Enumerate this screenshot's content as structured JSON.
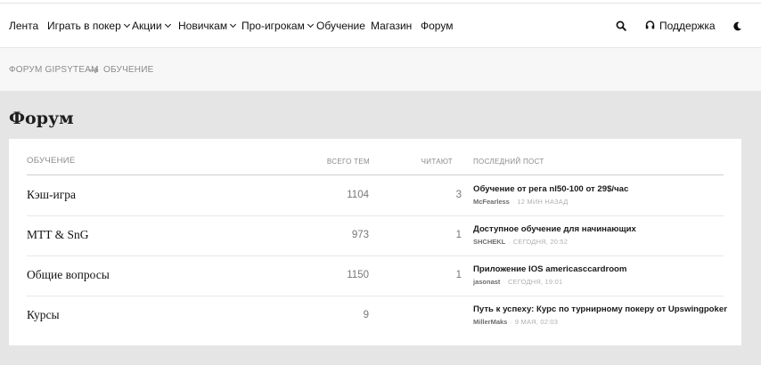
{
  "nav": {
    "items": [
      {
        "label": "Лента",
        "dropdown": false
      },
      {
        "label": "Играть в покер",
        "dropdown": true
      },
      {
        "label": "Акции",
        "dropdown": true
      },
      {
        "label": "Новичкам",
        "dropdown": true
      },
      {
        "label": "Про-игрокам",
        "dropdown": true
      },
      {
        "label": "Обучение",
        "dropdown": false
      },
      {
        "label": "Магазин",
        "dropdown": false
      },
      {
        "label": "Форум",
        "dropdown": false
      }
    ],
    "support_label": "Поддержка",
    "icons": {
      "search": "search-icon",
      "support": "headset-icon",
      "theme": "moon-icon"
    }
  },
  "breadcrumb": {
    "items": [
      "ФОРУМ GIPSYTEAM",
      "ОБУЧЕНИЕ"
    ]
  },
  "page_title": "Форум",
  "table": {
    "section_label": "ОБУЧЕНИЕ",
    "col_topics": "ВСЕГО ТЕМ",
    "col_readers": "ЧИТАЮТ",
    "col_last_post": "ПОСЛЕДНИЙ ПОСТ",
    "rows": [
      {
        "name": "Кэш-игра",
        "topics": "1104",
        "readers": "3",
        "post_title": "Обучение от рега nl50-100 от 29$/час",
        "post_author": "McFearless",
        "post_time": "12 МИН НАЗАД"
      },
      {
        "name": "MTT & SnG",
        "topics": "973",
        "readers": "1",
        "post_title": "Доступное обучение для начинающих",
        "post_author": "SHCHEKL",
        "post_time": "СЕГОДНЯ, 20:52"
      },
      {
        "name": "Общие вопросы",
        "topics": "1150",
        "readers": "1",
        "post_title": "Приложение IOS americasccardroom",
        "post_author": "jasonast",
        "post_time": "СЕГОДНЯ, 19:01"
      },
      {
        "name": "Курсы",
        "topics": "9",
        "readers": "",
        "post_title": "Путь к успеху: Курс по турнирному покеру от Upswingpoker",
        "post_author": "MillerMaks",
        "post_time": "9 МАЯ, 02:03"
      }
    ]
  },
  "colors": {
    "page_bg": "#e5e5e5",
    "card_bg": "#ffffff",
    "muted_text": "#8a8a8a"
  }
}
